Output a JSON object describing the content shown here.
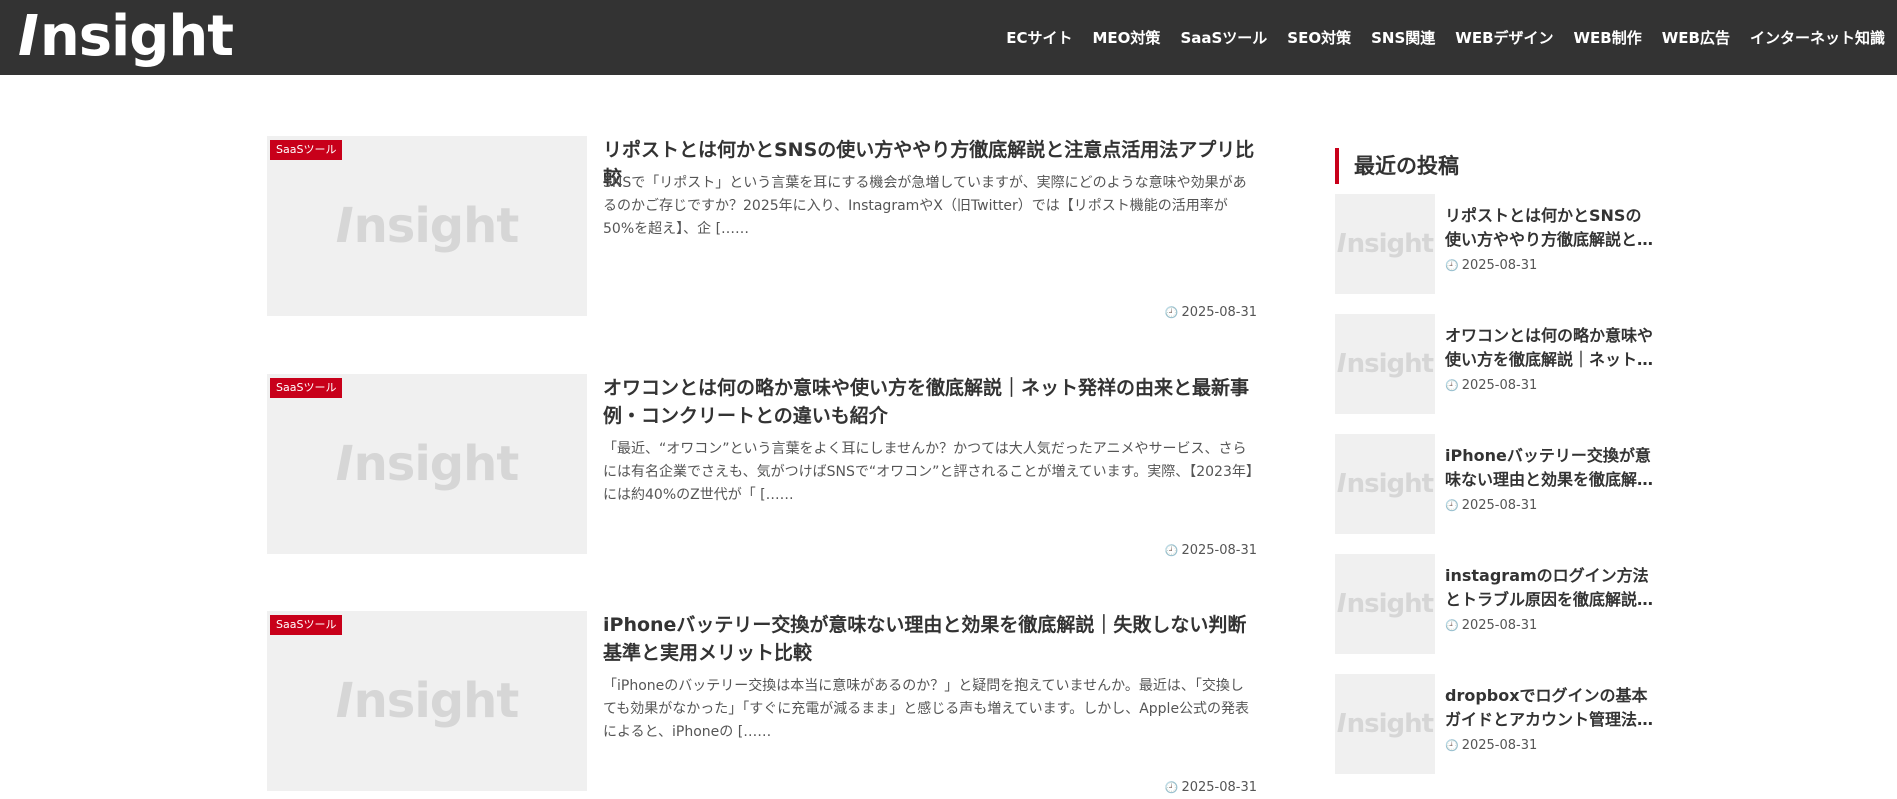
{
  "site": {
    "logo_initial": "I",
    "logo_rest": "nsight"
  },
  "nav": {
    "items": [
      "ECサイト",
      "MEO対策",
      "SaaSツール",
      "SEO対策",
      "SNS関連",
      "WEBデザイン",
      "WEB制作",
      "WEB広告",
      "インターネット知識"
    ]
  },
  "posts": [
    {
      "category": "SaaSツール",
      "title": "リポストとは何かとSNSの使い方ややり方徹底解説と注意点活用法アプリ比較",
      "excerpt": "SNSで「リポスト」という言葉を耳にする機会が急増していますが、実際にどのような意味や効果があるのかご存じですか？2025年に入り、InstagramやX（旧Twitter）では【リポスト機能の活用率が50%を超え】、企 [……",
      "date": "2025-08-31"
    },
    {
      "category": "SaaSツール",
      "title": "オワコンとは何の略か意味や使い方を徹底解説｜ネット発祥の由来と最新事例・コンクリートとの違いも紹介",
      "excerpt": "「最近、“オワコン”という言葉をよく耳にしませんか？かつては大人気だったアニメやサービス、さらには有名企業でさえも、気がつけばSNSで“オワコン”と評されることが増えています。実際、【2023年】には約40%のZ世代が「 [……",
      "date": "2025-08-31"
    },
    {
      "category": "SaaSツール",
      "title": "iPhoneバッテリー交換が意味ない理由と効果を徹底解説｜失敗しない判断基準と実用メリット比較",
      "excerpt": "「iPhoneのバッテリー交換は本当に意味があるのか？」と疑問を抱えていませんか。最近は、「交換しても効果がなかった」「すぐに充電が減るまま」と感じる声も増えています。しかし、Apple公式の発表によると、iPhoneの [……",
      "date": "2025-08-31"
    }
  ],
  "sidebar": {
    "title": "最近の投稿",
    "recent": [
      {
        "title": "リポストとは何かとSNSの使い方ややり方徹底解説と注意点活用法アプリ比較",
        "date": "2025-08-31"
      },
      {
        "title": "オワコンとは何の略か意味や使い方を徹底解説｜ネット発祥の由来と最新事例",
        "date": "2025-08-31"
      },
      {
        "title": "iPhoneバッテリー交換が意味ない理由と効果を徹底解説｜失敗しない判断基準",
        "date": "2025-08-31"
      },
      {
        "title": "instagramのログイン方法とトラブル原因を徹底解説｜対処法",
        "date": "2025-08-31"
      },
      {
        "title": "dropboxでログインの基本ガイドとアカウント管理法｜使い方",
        "date": "2025-08-31"
      }
    ]
  }
}
